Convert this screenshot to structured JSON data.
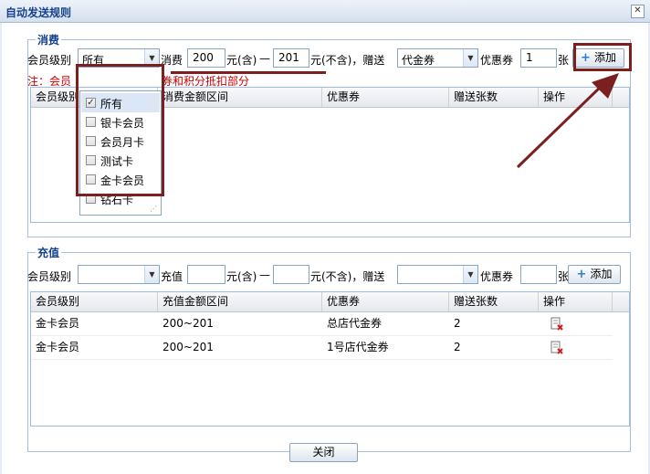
{
  "dialog": {
    "title": "自动发送规则",
    "close_glyph": "✕"
  },
  "consume": {
    "legend": "消费",
    "level_label": "会员级别",
    "level_value": "所有",
    "amount_label": "消费",
    "from_value": "200",
    "from_unit": "元(含)",
    "dash": "—",
    "to_value": "201",
    "to_unit": "元(不含)，赠送",
    "gift_type": "代金券",
    "coupon_label": "优惠券",
    "coupon_qty": "1",
    "qty_unit": "张",
    "add_label": "添加",
    "note_prefix": "注：会员",
    "note_tail": "券和积分抵扣部分",
    "columns": [
      "会员级别",
      "消费金额区间",
      "优惠券",
      "赠送张数",
      "操作"
    ],
    "level_options": [
      {
        "label": "所有",
        "checked": true
      },
      {
        "label": "银卡会员",
        "checked": false
      },
      {
        "label": "会员月卡",
        "checked": false
      },
      {
        "label": "测试卡",
        "checked": false
      },
      {
        "label": "金卡会员",
        "checked": false
      },
      {
        "label": "钻石卡",
        "checked": false
      }
    ]
  },
  "recharge": {
    "legend": "充值",
    "level_label": "会员级别",
    "level_value": "",
    "amount_label": "充值",
    "from_value": "",
    "from_unit": "元(含)",
    "dash": "—",
    "to_value": "",
    "to_unit": "元(不含)，赠送",
    "gift_type": "",
    "coupon_label": "优惠券",
    "coupon_qty": "",
    "qty_unit": "张",
    "add_label": "添加",
    "columns": [
      "会员级别",
      "充值金额区间",
      "优惠券",
      "赠送张数",
      "操作"
    ],
    "rows": [
      {
        "level": "金卡会员",
        "range": "200~201",
        "coupon": "总店代金券",
        "count": "2"
      },
      {
        "level": "金卡会员",
        "range": "200~201",
        "coupon": "1号店代金券",
        "count": "2"
      }
    ]
  },
  "footer": {
    "close_label": "关闭"
  },
  "colors": {
    "annotation": "#7b1f1f",
    "note": "#cc0000",
    "legend": "#15428b"
  }
}
